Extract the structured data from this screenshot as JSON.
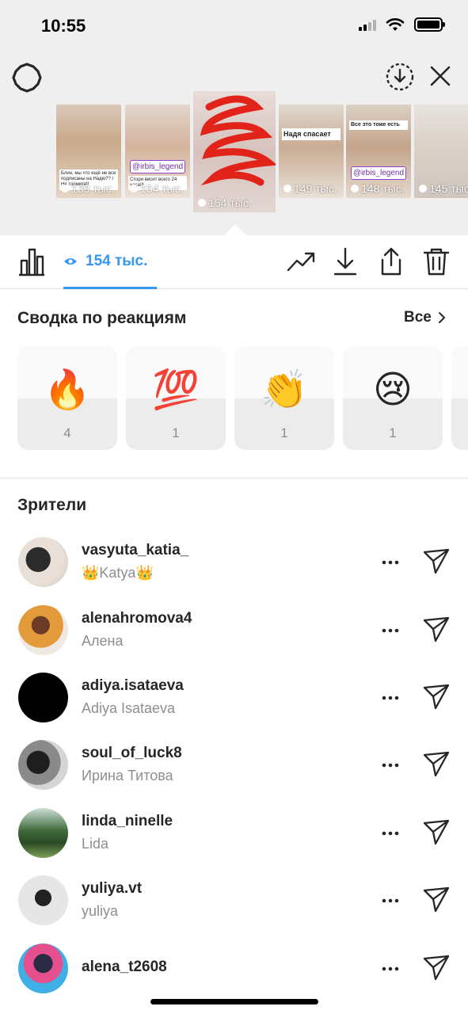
{
  "status_bar": {
    "time": "10:55"
  },
  "header": {
    "settings_icon": "gear-icon",
    "save_icon": "download-circle-icon",
    "close_icon": "close-icon"
  },
  "stories": [
    {
      "views": "139 тыс.",
      "note": "Блин, мы что ещё не все подписаны на Надю?? / Не тормите!!"
    },
    {
      "views": "154 тыс.",
      "tag": "@irbis_legend",
      "note": "Стори висит всего 24 часа!!!"
    },
    {
      "views": "154 тыс.",
      "active": true
    },
    {
      "views": "149 тыс.",
      "note": "Надя спасает"
    },
    {
      "views": "148 тыс.",
      "tag": "@irbis_legend",
      "note": "Все это тоже есть"
    },
    {
      "views": "145 тыс."
    }
  ],
  "toolbar": {
    "views_count": "154 тыс.",
    "icons": [
      "bar-chart-icon",
      "eye-icon",
      "trend-icon",
      "download-icon",
      "share-icon",
      "trash-icon"
    ],
    "accent_color": "#3897f0"
  },
  "reactions": {
    "title": "Сводка по реакциям",
    "see_all": "Все",
    "items": [
      {
        "emoji": "🔥",
        "count": "4"
      },
      {
        "emoji": "💯",
        "count": "1"
      },
      {
        "emoji": "👏",
        "count": "1"
      },
      {
        "emoji": "😢",
        "count": "1"
      }
    ]
  },
  "viewers": {
    "title": "Зрители",
    "items": [
      {
        "username": "vasyuta_katia_",
        "name": "👑Katya👑"
      },
      {
        "username": "alenahromova4",
        "name": "Алена"
      },
      {
        "username": "adiya.isataeva",
        "name": "Adiya Isataeva"
      },
      {
        "username": "soul_of_luck8",
        "name": "Ирина Титова"
      },
      {
        "username": "linda_ninelle",
        "name": "Lida"
      },
      {
        "username": "yuliya.vt",
        "name": "yuliya"
      },
      {
        "username": "alena_t2608",
        "name": ""
      }
    ]
  }
}
